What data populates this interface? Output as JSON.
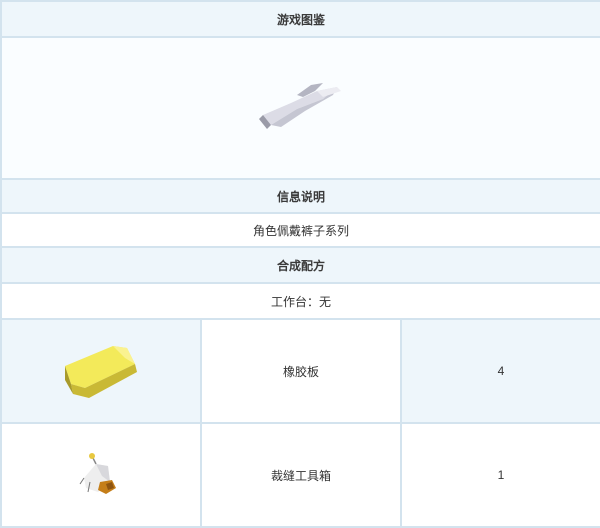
{
  "sections": {
    "gallery_title": "游戏图鉴",
    "info_title": "信息说明",
    "info_text": "角色佩戴裤子系列",
    "recipe_title": "合成配方",
    "workbench_text": "工作台：无"
  },
  "gallery": {
    "icon": "pants-item-icon"
  },
  "recipe_rows": [
    {
      "icon": "rubber-board-icon",
      "name": "橡胶板",
      "qty": "4"
    },
    {
      "icon": "tailoring-toolbox-icon",
      "name": "裁缝工具箱",
      "qty": "1"
    }
  ],
  "colors": {
    "header_bg": "#eef6fb",
    "border": "#d3e3ee",
    "rubber_yellow": "#f3ea5a"
  }
}
